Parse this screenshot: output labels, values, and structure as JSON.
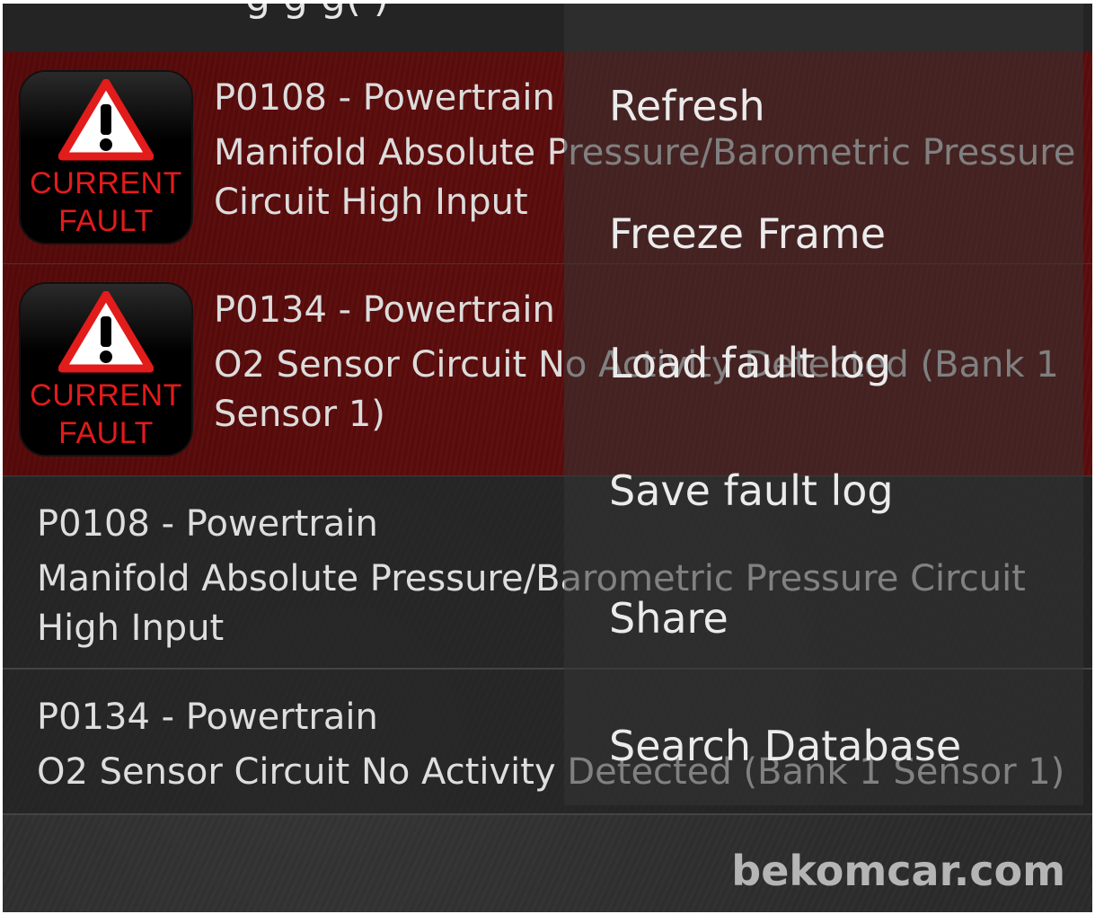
{
  "titlebar": {
    "partial_title": "g           g                     g(      )"
  },
  "active_faults": [
    {
      "badge_line1": "CURRENT",
      "badge_line2": "FAULT",
      "code": "P0108 - Powertrain",
      "description": "Manifold Absolute Pressure/Barometric Pressure Circuit High Input"
    },
    {
      "badge_line1": "CURRENT",
      "badge_line2": "FAULT",
      "code": "P0134 - Powertrain",
      "description": "O2 Sensor Circuit No Activity Detected (Bank 1 Sensor 1)"
    }
  ],
  "history_faults": [
    {
      "code": "P0108 - Powertrain",
      "description": "Manifold Absolute Pressure/Barometric Pressure Circuit High Input"
    },
    {
      "code": "P0134 - Powertrain",
      "description": "O2 Sensor Circuit No Activity Detected (Bank 1 Sensor 1)"
    }
  ],
  "menu": {
    "items": [
      "Refresh",
      "Freeze Frame",
      "Load fault log",
      "Save fault log",
      "Share",
      "Search Database"
    ]
  },
  "watermark": "bekomcar.com",
  "icons": {
    "fault_badge": "warning-triangle-icon"
  },
  "colors": {
    "fault_row": "#5c0d0d",
    "badge_text": "#e21b1b",
    "background": "#2b2b2b"
  }
}
